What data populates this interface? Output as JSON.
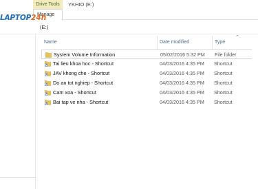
{
  "ribbon": {
    "context_tab": "Drive Tools",
    "window_title": "YKHIO (E:)",
    "manage_tab": "Manage"
  },
  "address": {
    "path": "(E:)"
  },
  "logo": {
    "main": "LAPTOP",
    "num": "24h"
  },
  "columns": {
    "name": "Name",
    "date": "Date modified",
    "type": "Type"
  },
  "files": [
    {
      "name": "System Volume Information",
      "date": "05/02/2016 5:32 PM",
      "type": "File folder",
      "icon": "folder-icon"
    },
    {
      "name": "Tai lieu khoa hoc - Shortcut",
      "date": "04/03/2016 4:35 PM",
      "type": "Shortcut",
      "icon": "shortcut-folder-icon"
    },
    {
      "name": "JAV khong che - Shortcut",
      "date": "04/03/2016 4:35 PM",
      "type": "Shortcut",
      "icon": "shortcut-folder-icon"
    },
    {
      "name": "Do an tot nghiep - Shortcut",
      "date": "04/03/2016 4:35 PM",
      "type": "Shortcut",
      "icon": "shortcut-folder-icon"
    },
    {
      "name": "Cam xoa - Shortcut",
      "date": "04/03/2016 4:35 PM",
      "type": "Shortcut",
      "icon": "shortcut-folder-icon"
    },
    {
      "name": "Bai tap ve nha - Shortcut",
      "date": "04/03/2016 4:35 PM",
      "type": "Shortcut",
      "icon": "shortcut-folder-icon"
    }
  ],
  "colors": {
    "folder": "#e8c25a",
    "folder_dark": "#d4a73a",
    "link_blue": "#4d6a8a",
    "context_tab_bg": "#f5eabb"
  }
}
